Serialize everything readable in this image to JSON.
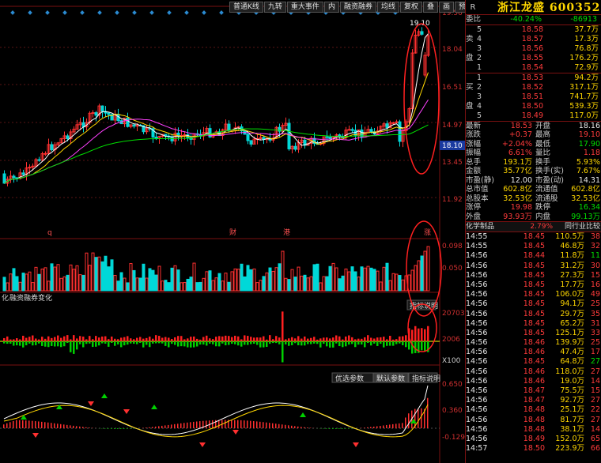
{
  "toolbar": {
    "items": [
      "普通K线",
      "九转",
      "重大事件",
      "内",
      "融资融券",
      "均线",
      "复权",
      "叠",
      "画",
      "预测",
      "己"
    ],
    "arrows": "◆ ▸ ▴"
  },
  "price_axis": {
    "labels": [
      "19.56",
      "18.04",
      "16.51",
      "14.97",
      "13.45",
      "11.92"
    ],
    "current": "18.10",
    "high_mark": "19.10"
  },
  "volume_axis": {
    "labels": [
      "0.098",
      "0.050"
    ]
  },
  "margin_panel": {
    "title": "融资融券变化",
    "help": "指标说明",
    "labels": [
      "20703",
      "2006"
    ],
    "multiplier": "X100"
  },
  "macd_panel": {
    "labels": [
      "0.650",
      "0.360",
      "-0.129"
    ],
    "buttons": [
      "优选参数",
      "默认参数",
      "指标说明"
    ]
  },
  "event_markers": [
    "q",
    "财",
    "港",
    "涨"
  ],
  "stock": {
    "title": "浙江龙盛 600352",
    "r_label": "R"
  },
  "weibi": {
    "label": "委比",
    "pct": "-40.24%",
    "diff": "-86913"
  },
  "sell_side": "卖盘",
  "buy_side": "买盘",
  "sell_orders": [
    {
      "lv": "5",
      "price": "18.58",
      "vol": "37.7万"
    },
    {
      "lv": "4",
      "price": "18.57",
      "vol": "17.3万"
    },
    {
      "lv": "3",
      "price": "18.56",
      "vol": "76.8万"
    },
    {
      "lv": "2",
      "price": "18.55",
      "vol": "176.2万"
    },
    {
      "lv": "1",
      "price": "18.54",
      "vol": "72.9万"
    }
  ],
  "buy_orders": [
    {
      "lv": "1",
      "price": "18.53",
      "vol": "94.2万"
    },
    {
      "lv": "2",
      "price": "18.52",
      "vol": "317.1万"
    },
    {
      "lv": "3",
      "price": "18.51",
      "vol": "741.7万"
    },
    {
      "lv": "4",
      "price": "18.50",
      "vol": "539.3万"
    },
    {
      "lv": "5",
      "price": "18.49",
      "vol": "117.0万"
    }
  ],
  "quote": [
    {
      "l1": "最新",
      "v1": "18.53",
      "c1": "red",
      "l2": "开盘",
      "v2": "18.16",
      "c2": "white"
    },
    {
      "l1": "涨跌",
      "v1": "+0.37",
      "c1": "red",
      "l2": "最高",
      "v2": "19.10",
      "c2": "red"
    },
    {
      "l1": "涨幅",
      "v1": "+2.04%",
      "c1": "red",
      "l2": "最低",
      "v2": "17.90",
      "c2": "green"
    },
    {
      "l1": "振幅",
      "v1": "6.61%",
      "c1": "red",
      "l2": "量比",
      "v2": "1.18",
      "c2": "red"
    },
    {
      "l1": "总手",
      "v1": "193.1万",
      "c1": "yellow",
      "l2": "换手",
      "v2": "5.93%",
      "c2": "yellow"
    },
    {
      "l1": "金额",
      "v1": "35.77亿",
      "c1": "yellow",
      "l2": "换手(实)",
      "v2": "7.67%",
      "c2": "yellow"
    },
    {
      "l1": "市盈(静)",
      "v1": "12.00",
      "c1": "white",
      "l2": "市盈(动)",
      "v2": "14.31",
      "c2": "white"
    },
    {
      "l1": "总市值",
      "v1": "602.8亿",
      "c1": "yellow",
      "l2": "流通值",
      "v2": "602.8亿",
      "c2": "yellow"
    },
    {
      "l1": "总股本",
      "v1": "32.53亿",
      "c1": "yellow",
      "l2": "流通股",
      "v2": "32.53亿",
      "c2": "yellow"
    },
    {
      "l1": "涨停",
      "v1": "19.98",
      "c1": "red",
      "l2": "跌停",
      "v2": "16.34",
      "c2": "green"
    },
    {
      "l1": "外盘",
      "v1": "93.93万",
      "c1": "red",
      "l2": "内盘",
      "v2": "99.13万",
      "c2": "green"
    }
  ],
  "sector": {
    "name": "化学制品",
    "pct": "2.79%",
    "compare": "同行业比较"
  },
  "ticks": [
    {
      "t": "14:55",
      "p": "18.45",
      "v": "110.5万",
      "n": "38"
    },
    {
      "t": "14:55",
      "p": "18.45",
      "v": "46.8万",
      "n": "32"
    },
    {
      "t": "14:56",
      "p": "18.44",
      "v": "11.8万",
      "n": "11"
    },
    {
      "t": "14:56",
      "p": "18.45",
      "v": "31.2万",
      "n": "30"
    },
    {
      "t": "14:56",
      "p": "18.45",
      "v": "27.3万",
      "n": "15"
    },
    {
      "t": "14:56",
      "p": "18.45",
      "v": "17.7万",
      "n": "16"
    },
    {
      "t": "14:56",
      "p": "18.45",
      "v": "106.0万",
      "n": "49"
    },
    {
      "t": "14:56",
      "p": "18.45",
      "v": "94.1万",
      "n": "25"
    },
    {
      "t": "14:56",
      "p": "18.45",
      "v": "29.7万",
      "n": "35"
    },
    {
      "t": "14:56",
      "p": "18.45",
      "v": "65.2万",
      "n": "31"
    },
    {
      "t": "14:56",
      "p": "18.45",
      "v": "125.1万",
      "n": "33"
    },
    {
      "t": "14:56",
      "p": "18.46",
      "v": "139.9万",
      "n": "25"
    },
    {
      "t": "14:56",
      "p": "18.46",
      "v": "47.4万",
      "n": "17"
    },
    {
      "t": "14:56",
      "p": "18.45",
      "v": "64.8万",
      "n": "27"
    },
    {
      "t": "14:56",
      "p": "18.46",
      "v": "118.0万",
      "n": "27"
    },
    {
      "t": "14:56",
      "p": "18.46",
      "v": "19.0万",
      "n": "14"
    },
    {
      "t": "14:56",
      "p": "18.47",
      "v": "75.5万",
      "n": "15"
    },
    {
      "t": "14:56",
      "p": "18.47",
      "v": "92.7万",
      "n": "27"
    },
    {
      "t": "14:56",
      "p": "18.48",
      "v": "25.1万",
      "n": "22"
    },
    {
      "t": "14:56",
      "p": "18.48",
      "v": "81.7万",
      "n": "27"
    },
    {
      "t": "14:56",
      "p": "18.48",
      "v": "38.1万",
      "n": "14"
    },
    {
      "t": "14:56",
      "p": "18.49",
      "v": "152.0万",
      "n": "65"
    },
    {
      "t": "14:57",
      "p": "18.50",
      "v": "223.9万",
      "n": "66"
    }
  ],
  "tick_colors": [
    "red",
    "red",
    "green",
    "red",
    "red",
    "red",
    "red",
    "red",
    "red",
    "red",
    "red",
    "red",
    "red",
    "green",
    "red",
    "red",
    "red",
    "red",
    "red",
    "red",
    "red",
    "red",
    "red"
  ]
}
